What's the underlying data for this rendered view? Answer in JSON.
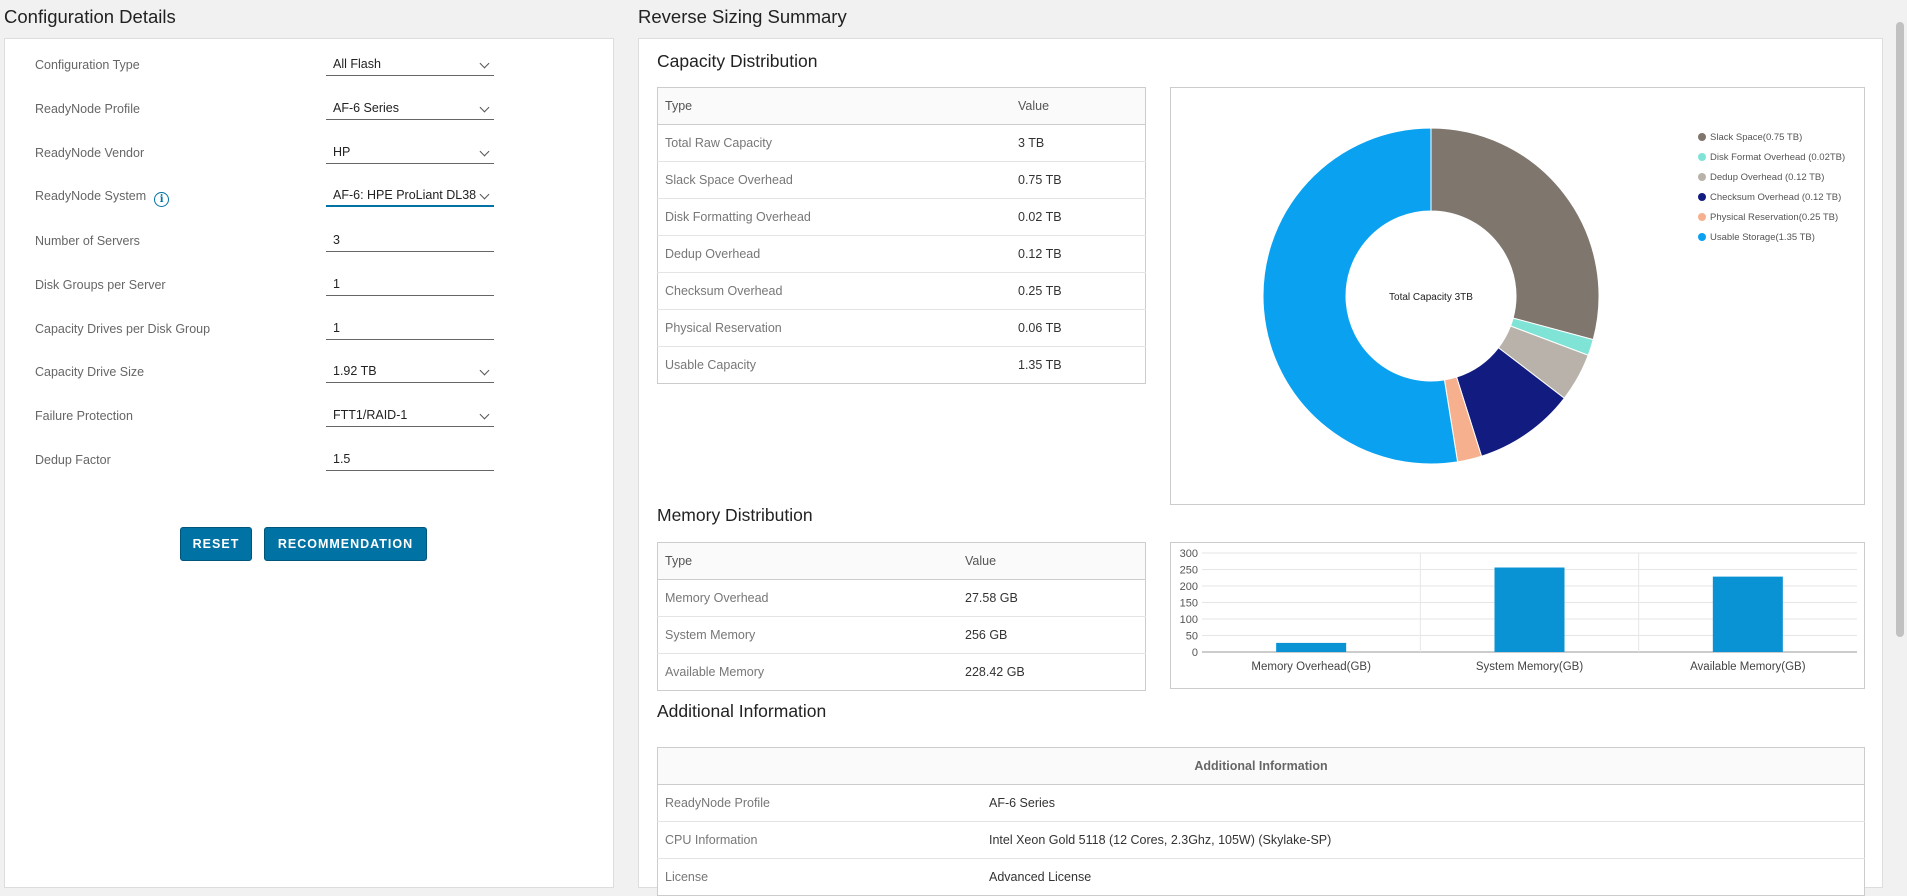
{
  "left": {
    "title": "Configuration Details",
    "fields": [
      {
        "label": "Configuration Type",
        "value": "All Flash",
        "type": "select"
      },
      {
        "label": "ReadyNode Profile",
        "value": "AF-6 Series",
        "type": "select"
      },
      {
        "label": "ReadyNode Vendor",
        "value": "HP",
        "type": "select"
      },
      {
        "label": "ReadyNode System",
        "value": "AF-6: HPE ProLiant DL38",
        "type": "select",
        "info_icon": "info-icon"
      },
      {
        "label": "Number of Servers",
        "value": "3",
        "type": "input"
      },
      {
        "label": "Disk Groups per Server",
        "value": "1",
        "type": "input"
      },
      {
        "label": "Capacity Drives per Disk Group",
        "value": "1",
        "type": "input"
      },
      {
        "label": "Capacity Drive Size",
        "value": "1.92 TB",
        "type": "select"
      },
      {
        "label": "Failure Protection",
        "value": "FTT1/RAID-1",
        "type": "select"
      },
      {
        "label": "Dedup Factor",
        "value": "1.5",
        "type": "input"
      }
    ],
    "buttons": {
      "reset": "RESET",
      "recommendation": "RECOMMENDATION"
    }
  },
  "right": {
    "title": "Reverse Sizing Summary",
    "capacity": {
      "title": "Capacity Distribution",
      "headers": [
        "Type",
        "Value"
      ],
      "rows": [
        [
          "Total Raw Capacity",
          "3 TB"
        ],
        [
          "Slack Space Overhead",
          "0.75 TB"
        ],
        [
          "Disk Formatting Overhead",
          "0.02 TB"
        ],
        [
          "Dedup Overhead",
          "0.12 TB"
        ],
        [
          "Checksum Overhead",
          "0.25 TB"
        ],
        [
          "Physical Reservation",
          "0.06 TB"
        ],
        [
          "Usable Capacity",
          "1.35 TB"
        ]
      ]
    },
    "memory": {
      "title": "Memory Distribution",
      "headers": [
        "Type",
        "Value"
      ],
      "rows": [
        [
          "Memory Overhead",
          "27.58 GB"
        ],
        [
          "System Memory",
          "256 GB"
        ],
        [
          "Available Memory",
          "228.42 GB"
        ]
      ]
    },
    "additional": {
      "title": "Additional Information",
      "header": "Additional Information",
      "rows": [
        [
          "ReadyNode Profile",
          "AF-6 Series"
        ],
        [
          "CPU Information",
          "Intel Xeon Gold 5118 (12 Cores, 2.3Ghz, 105W) (Skylake-SP)"
        ],
        [
          "License",
          "Advanced License"
        ]
      ]
    }
  },
  "chart_data": [
    {
      "type": "pie",
      "donut": true,
      "center_label": "Total Capacity 3TB",
      "legend_position": "top-right",
      "slices": [
        {
          "name": "Slack Space(0.75 TB)",
          "value": 0.75,
          "color": "#7f766d"
        },
        {
          "name": "Disk Format Overhead (0.02TB)",
          "value": 0.04,
          "color": "#7fe3d6"
        },
        {
          "name": "Dedup Overhead (0.12 TB)",
          "value": 0.12,
          "color": "#b8b2aa"
        },
        {
          "name": "Checksum Overhead (0.12 TB)",
          "value": 0.25,
          "color": "#121c80"
        },
        {
          "name": "Physical Reservation(0.25 TB)",
          "value": 0.06,
          "color": "#f7b08e"
        },
        {
          "name": "Usable Storage(1.35 TB)",
          "value": 1.35,
          "color": "#0aa2f0"
        }
      ]
    },
    {
      "type": "bar",
      "categories": [
        "Memory Overhead(GB)",
        "System Memory(GB)",
        "Available Memory(GB)"
      ],
      "values": [
        27.58,
        256,
        228.42
      ],
      "ylim": [
        0,
        300
      ],
      "yticks": [
        0,
        50,
        100,
        150,
        200,
        250,
        300
      ],
      "color": "#0a93d4",
      "grid": true
    }
  ]
}
